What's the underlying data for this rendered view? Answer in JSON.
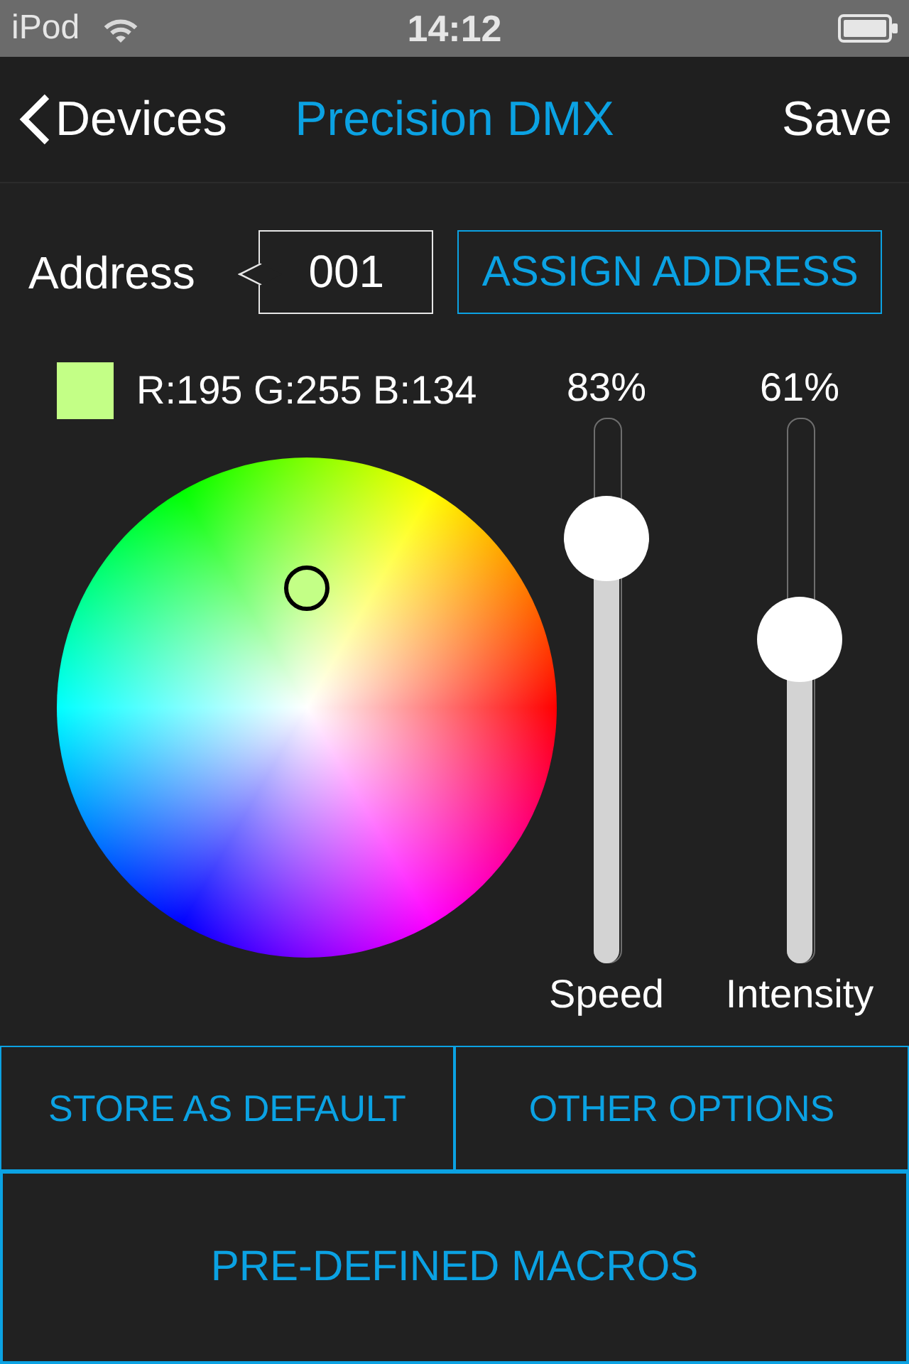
{
  "status_bar": {
    "carrier": "iPod",
    "time": "14:12"
  },
  "nav_bar": {
    "back": "Devices",
    "title": "Precision DMX",
    "action": "Save"
  },
  "address": {
    "label": "Address",
    "value": "001",
    "button": "ASSIGN ADDRESS"
  },
  "color_picker": {
    "color": "#c3ff86",
    "reading": "R:195 G:255 B:134"
  },
  "sliders": [
    {
      "reading": "83%",
      "label": "Speed",
      "level": 0.83
    },
    {
      "reading": "61%",
      "label": "Intensity",
      "level": 0.61
    }
  ],
  "buttons": [
    "STORE AS DEFAULT",
    "OTHER OPTIONS",
    "PRE-DEFINED MACROS"
  ]
}
